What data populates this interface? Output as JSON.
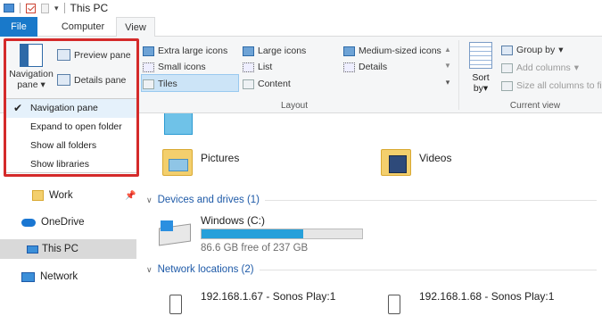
{
  "window": {
    "title": "This PC"
  },
  "tabs": [
    {
      "label": "File"
    },
    {
      "label": "Computer"
    },
    {
      "label": "View"
    }
  ],
  "ribbon": {
    "panes": {
      "navigation_pane_label": "Navigation pane",
      "navigation_pane_line1": "Navigation",
      "navigation_pane_line2": "pane",
      "preview_pane": "Preview pane",
      "details_pane": "Details pane"
    },
    "layout": {
      "label": "Layout",
      "extra_large_icons": "Extra large icons",
      "large_icons": "Large icons",
      "medium_icons": "Medium-sized icons",
      "small_icons": "Small icons",
      "list": "List",
      "details": "Details",
      "tiles": "Tiles",
      "content": "Content",
      "selected": "Tiles"
    },
    "current_view": {
      "label": "Current view",
      "sort_by_line1": "Sort",
      "sort_by_line2": "by",
      "group_by": "Group by",
      "add_columns": "Add columns",
      "size_all_columns": "Size all columns to fit"
    }
  },
  "navigation_dropdown": {
    "items": [
      {
        "label": "Navigation pane",
        "checked": true
      },
      {
        "label": "Expand to open folder",
        "checked": false
      },
      {
        "label": "Show all folders",
        "checked": false
      },
      {
        "label": "Show libraries",
        "checked": false
      }
    ]
  },
  "sidebar": {
    "items": [
      {
        "label": "Work",
        "pinned": true
      },
      {
        "label": "OneDrive"
      },
      {
        "label": "This PC",
        "selected": true
      },
      {
        "label": "Network"
      }
    ]
  },
  "main": {
    "folders": [
      {
        "label": "Pictures"
      },
      {
        "label": "Videos"
      }
    ],
    "devices_section": {
      "title": "Devices and drives (1)"
    },
    "drive": {
      "name": "Windows (C:)",
      "free_text": "86.6 GB free of 237 GB",
      "used_fraction": 0.635
    },
    "network_section": {
      "title": "Network locations (2)"
    },
    "network_locations": [
      {
        "label": "192.168.1.67 - Sonos Play:1"
      },
      {
        "label": "192.168.1.68 - Sonos Play:1"
      }
    ]
  },
  "colors": {
    "accent": "#1979ca",
    "highlight_border": "#d42a2a",
    "drive_bar": "#26a0da",
    "section_header": "#1e5aa8"
  }
}
